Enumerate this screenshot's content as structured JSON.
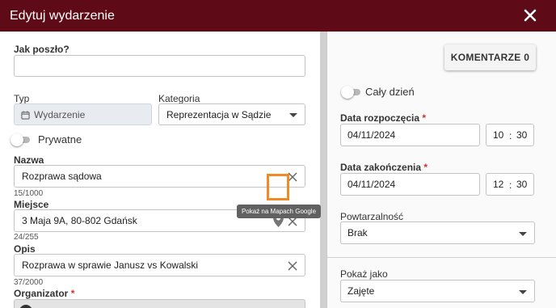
{
  "dialog": {
    "title": "Edytuj wydarzenie"
  },
  "left": {
    "how_label": "Jak poszło?",
    "how_value": "",
    "type_label": "Typ",
    "type_value": "Wydarzenie",
    "category_label": "Kategoria",
    "category_value": "Reprezentacja w Sądzie",
    "private_label": "Prywatne",
    "name_label": "Nazwa",
    "name_value": "Rozprawa sądowa",
    "name_counter": "15/1000",
    "place_label": "Miejsce",
    "place_value": "3 Maja 9A, 80-802 Gdańsk",
    "place_counter": "24/255",
    "map_tooltip": "Pokaż na Mapach Google",
    "desc_label": "Opis",
    "desc_value": "Rozprawa w sprawie Janusz vs Kowalski",
    "desc_counter": "37/2000",
    "organizer_label": "Organizator",
    "required_mark": "*"
  },
  "right": {
    "comments_button": "KOMENTARZE 0",
    "all_day_label": "Cały dzień",
    "start_label": "Data rozpoczęcia",
    "start_date": "04/11/2024",
    "start_hour": "10",
    "start_min": "30",
    "end_label": "Data zakończenia",
    "end_date": "04/11/2024",
    "end_hour": "12",
    "end_min": "30",
    "time_sep": ":",
    "repeat_label": "Powtarzalność",
    "repeat_value": "Brak",
    "show_as_label": "Pokaż jako",
    "show_as_value": "Zajęte"
  },
  "colors": {
    "header": "#5e0b17",
    "highlight": "#f08a24",
    "required": "#d32f2f"
  }
}
